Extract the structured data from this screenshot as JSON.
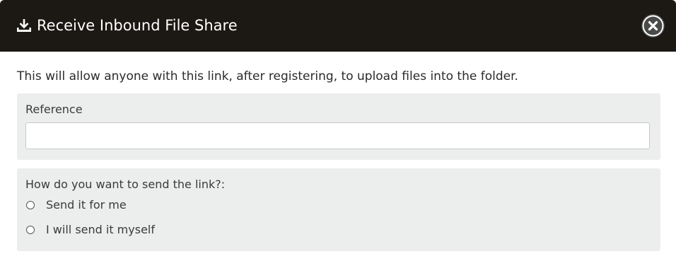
{
  "dialog": {
    "title": "Receive Inbound File Share",
    "title_icon": "download-icon",
    "close_icon": "close-icon"
  },
  "intro_text": "This will allow anyone with this link, after registering, to upload files into the folder.",
  "reference": {
    "label": "Reference",
    "value": "",
    "placeholder": ""
  },
  "send_method": {
    "question": "How do you want to send the link?:",
    "options": [
      {
        "label": "Send it for me",
        "selected": false
      },
      {
        "label": "I will send it myself",
        "selected": false
      }
    ]
  },
  "colors": {
    "header_bg": "#1c1814",
    "panel_bg": "#eceeee",
    "close_bg": "#4a4a4a"
  }
}
